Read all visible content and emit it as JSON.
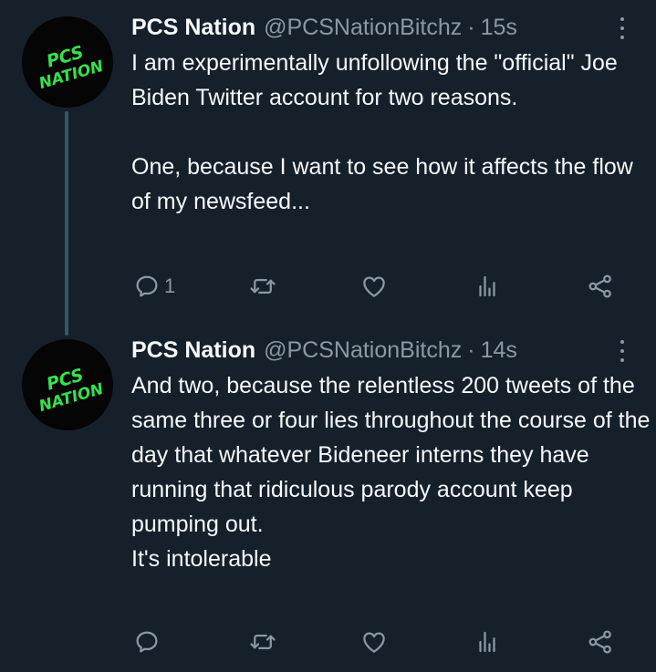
{
  "tweets": [
    {
      "name": "PCS Nation",
      "handle": "@PCSNationBitchz",
      "separator": "·",
      "time": "15s",
      "avatar": {
        "line1": "PCS",
        "line2": "NATION"
      },
      "lines": [
        "I am experimentally unfollowing the \"official\" Joe Biden Twitter account for two reasons.",
        "",
        "One, because I want to see how it affects the flow of my newsfeed..."
      ],
      "reply_count": "1"
    },
    {
      "name": "PCS Nation",
      "handle": "@PCSNationBitchz",
      "separator": "·",
      "time": "14s",
      "avatar": {
        "line1": "PCS",
        "line2": "NATION"
      },
      "lines": [
        "And two, because the relentless 200 tweets of the same three or four lies throughout the course of the day that whatever Bideneer interns they have running that ridiculous parody account keep pumping out.",
        "It's intolerable"
      ],
      "reply_count": ""
    }
  ],
  "icons": {
    "reply": "speech-bubble",
    "retweet": "retweet-arrows",
    "like": "heart-outline",
    "views": "bar-chart",
    "share": "share-nodes",
    "more": "vertical-ellipsis"
  },
  "colors": {
    "background": "#15202b",
    "text": "#f7f9f9",
    "muted": "#8b98a5",
    "thread_line": "#3d5466",
    "avatar_text": "#33e24c"
  }
}
